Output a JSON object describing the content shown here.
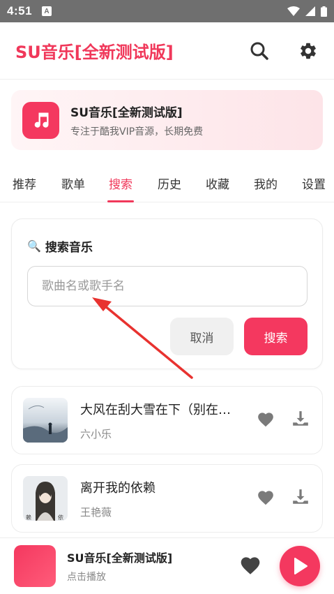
{
  "status_bar": {
    "time": "4:51",
    "notification_badge": "A"
  },
  "app": {
    "title": "SU音乐[全新测试版]"
  },
  "banner": {
    "name": "SU音乐[全新测试版]",
    "description": "专注于酷我VIP音源，长期免费"
  },
  "tabs": [
    {
      "label": "推荐"
    },
    {
      "label": "歌单"
    },
    {
      "label": "搜索",
      "active": true
    },
    {
      "label": "历史"
    },
    {
      "label": "收藏"
    },
    {
      "label": "我的"
    },
    {
      "label": "设置"
    }
  ],
  "search": {
    "heading_emoji": "🔍",
    "heading": "搜索音乐",
    "placeholder": "歌曲名或歌手名",
    "value": "",
    "cancel_label": "取消",
    "search_label": "搜索"
  },
  "results": [
    {
      "title": "大风在刮大雪在下（别在…",
      "artist": "六小乐"
    },
    {
      "title": "离开我的依赖",
      "artist": "王艳薇"
    }
  ],
  "player": {
    "title": "SU音乐[全新测试版]",
    "subtitle": "点击播放"
  },
  "colors": {
    "accent": "#f0385a",
    "status_bar": "#6f6f6f"
  }
}
